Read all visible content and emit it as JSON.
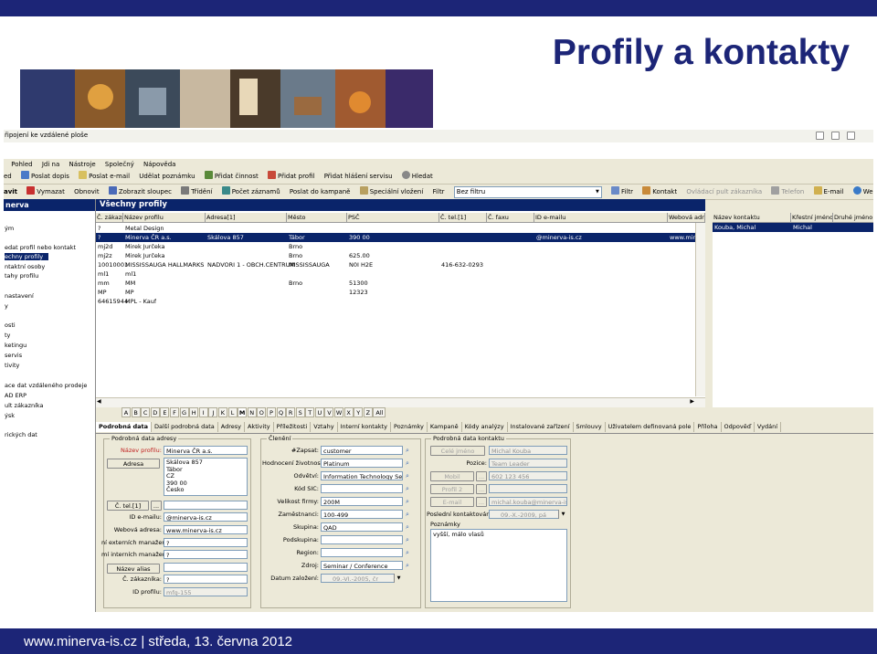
{
  "slide": {
    "title": "Profily a kontakty",
    "footer": "www.minerva-is.cz | středa, 13. června 2012"
  },
  "colors": {
    "slide_blue": "#1c2577",
    "selection": "#0a246a",
    "window": "#ece9d8"
  },
  "app": {
    "remote_bar": "řipojení ke vzdálené ploše",
    "menu": [
      "Pohled",
      "Jdi na",
      "Nástroje",
      "Společný",
      "Nápověda"
    ],
    "toolbar1": [
      "ed",
      "Poslat dopis",
      "Poslat e-mail",
      "Udělat poznámku",
      "Přidat činnost",
      "Přidat profil",
      "Přidat hlášení servisu",
      "Hledat"
    ],
    "toolbar2": [
      "avit",
      "Vymazat",
      "Obnovit",
      "Zobrazit sloupec",
      "Třídění",
      "Počet záznamů",
      "Poslat do kampaně",
      "Speciální vložení",
      "Filtr",
      "Bez filtru",
      "Filtr",
      "Kontakt",
      "Ovládací pult zákazníka",
      "Telefon",
      "E-mail",
      "Webová adresa"
    ],
    "left_pane": {
      "title": "nerva",
      "items": [
        "ým",
        "edat profil nebo kontakt",
        "echny profily",
        "ntaktní osoby",
        "tahy profilu",
        "nastavení",
        "y",
        "osti",
        "ty",
        "ketingu",
        "servis",
        "tivity",
        "ace dat vzdáleného prodeje",
        "AD ERP",
        "ult zákazníka",
        "ýsk",
        "rických dat"
      ]
    },
    "grid": {
      "title": "Všechny profily",
      "columns": [
        "Č. zákazn",
        "Název profilu",
        "Adresa[1]",
        "Město",
        "PSČ",
        "Č. tel.[1]",
        "Č. faxu",
        "ID e-mailu",
        "Webová adre"
      ],
      "rows": [
        [
          "?",
          "Metal Design",
          "",
          "",
          "",
          "",
          "",
          "",
          ""
        ],
        [
          "?",
          "Minerva ČR a.s.",
          "Skálova 857",
          "Tábor",
          "390 00",
          "",
          "",
          "@minerva-is.cz",
          "www.minerva"
        ],
        [
          "mj2d",
          "Mirek Jurčeka",
          "",
          "Brno",
          "",
          "",
          "",
          "",
          ""
        ],
        [
          "mj2z",
          "Mirek Jurčeka",
          "",
          "Brno",
          "625.00",
          "",
          "",
          "",
          ""
        ],
        [
          "10010001",
          "MISSISSAUGA HALLMARKS",
          "NADVORI 1 - OBCH.CENTRUM",
          "MISSISSAUGA",
          "N0I H2E",
          "416-632-0293",
          "",
          "",
          ""
        ],
        [
          "ml1",
          "ml1",
          "",
          "",
          "",
          "",
          "",
          "",
          ""
        ],
        [
          "mm",
          "MM",
          "",
          "Brno",
          "51300",
          "",
          "",
          "",
          ""
        ],
        [
          "MP",
          "MP",
          "",
          "",
          "12323",
          "",
          "",
          "",
          ""
        ],
        [
          "64615944",
          "MPL - Kauf",
          "",
          "",
          "",
          "",
          "",
          "",
          ""
        ]
      ]
    },
    "contacts": {
      "columns": [
        "Název kontaktu",
        "Křestní jméno",
        "Druhé jméno"
      ],
      "rows": [
        [
          "Kouba, Michal",
          "Michal",
          ""
        ]
      ]
    },
    "alphabet": [
      "A",
      "B",
      "C",
      "D",
      "E",
      "F",
      "G",
      "H",
      "I",
      "J",
      "K",
      "L",
      "M",
      "N",
      "O",
      "P",
      "Q",
      "R",
      "S",
      "T",
      "U",
      "V",
      "W",
      "X",
      "Y",
      "Z",
      "All"
    ],
    "alphabet_selected": "M",
    "tabs": [
      "Podrobná data",
      "Další podrobná data",
      "Adresy",
      "Aktivity",
      "Příležitosti",
      "Vztahy",
      "Interní kontakty",
      "Poznámky",
      "Kampaně",
      "Kódy analýzy",
      "Instalované zařízení",
      "Smlouvy",
      "Uživatelem definovaná pole",
      "Příloha",
      "Odpověď",
      "Vydání"
    ],
    "form": {
      "group_profile": "Podrobná data adresy",
      "profile_name_label": "Název profilu:",
      "profile_name": "Minerva ČR a.s.",
      "address_button": "Adresa",
      "address_lines": [
        "Skálova 857",
        "Tábor",
        "CZ",
        "390 00",
        "Česko"
      ],
      "phone_button": "Č. tel.[1]",
      "phone_dots": "...",
      "email_label": "ID e-mailu:",
      "email": "@minerva-is.cz",
      "web_label": "Webová adresa:",
      "web": "www.minerva-is.cz",
      "ext_mgr_label": "ní externích manažer",
      "ext_mgr": "?",
      "int_mgr_label": "mí interních manažer",
      "int_mgr": "?",
      "alias_button": "Název alias",
      "customer_no_label": "Č. zákazníka:",
      "customer_no": "?",
      "profile_id_label": "ID profilu:",
      "profile_id": "mfg-155",
      "group_member": "Členění",
      "record_label": "#Zapsat:",
      "record": "customer",
      "lifetime_label": "Hodnocení životnost:",
      "lifetime": "Platinum",
      "industry_label": "Odvětví:",
      "industry": "Information Technology Servic",
      "sic_label": "Kód SIC:",
      "sic": "",
      "size_label": "Velikost firmy:",
      "size": "200M",
      "employees_label": "Zaměstnanci:",
      "employees": "100-499",
      "group_label": "Skupina:",
      "group": "QAD",
      "subgroup_label": "Podskupina:",
      "subgroup": "",
      "region_label": "Region:",
      "region": "",
      "source_label": "Zdroj:",
      "source": "Seminar / Conference",
      "created_label": "Datum založení:",
      "created": "09.-VI.-2005, čr",
      "group_contact": "Podrobná data kontaktu",
      "fullname_button": "Celé jméno",
      "fullname": "Michal Kouba",
      "position_label": "Pozice:",
      "position": "Team Leader",
      "mobile_button": "Mobil",
      "mobile": "602 123 456",
      "profile2_button": "Profil 2",
      "email2_button": "E-mail",
      "email2": "michal.kouba@minerva-is.cz",
      "last_contact_label": "Poslední kontaktován:",
      "last_contact": "09.-X.-2009, pá",
      "notes_label": "Poznámky",
      "notes": "vyšší, málo vlasů",
      "dots": "..."
    }
  }
}
